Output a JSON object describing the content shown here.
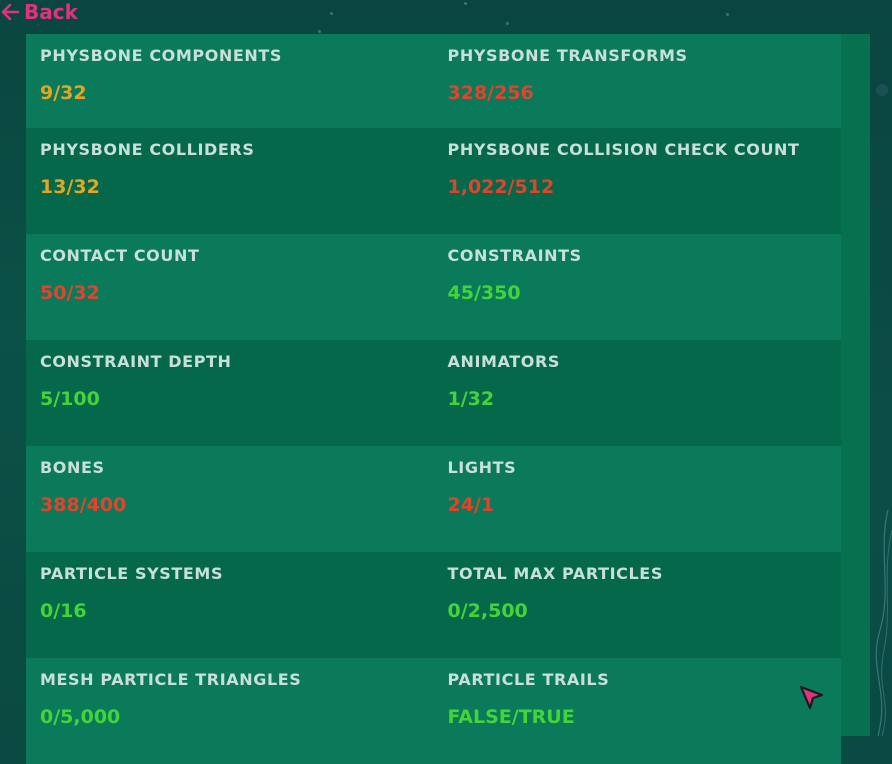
{
  "nav": {
    "back_label": "Back"
  },
  "colors": {
    "warning": "#e2a722",
    "error": "#e0452c",
    "ok": "#43d43a",
    "label": "#c8e0d8",
    "accent": "#e0337d"
  },
  "stats": [
    {
      "left": {
        "label": "PHYSBONE COMPONENTS",
        "value": "9/32",
        "status": "warning"
      },
      "right": {
        "label": "PHYSBONE TRANSFORMS",
        "value": "328/256",
        "status": "error"
      }
    },
    {
      "left": {
        "label": "PHYSBONE COLLIDERS",
        "value": "13/32",
        "status": "warning"
      },
      "right": {
        "label": "PHYSBONE COLLISION CHECK COUNT",
        "value": "1,022/512",
        "status": "error"
      }
    },
    {
      "left": {
        "label": "CONTACT COUNT",
        "value": "50/32",
        "status": "error"
      },
      "right": {
        "label": "CONSTRAINTS",
        "value": "45/350",
        "status": "ok"
      }
    },
    {
      "left": {
        "label": "CONSTRAINT DEPTH",
        "value": "5/100",
        "status": "ok"
      },
      "right": {
        "label": "ANIMATORS",
        "value": "1/32",
        "status": "ok"
      }
    },
    {
      "left": {
        "label": "BONES",
        "value": "388/400",
        "status": "error"
      },
      "right": {
        "label": "LIGHTS",
        "value": "24/1",
        "status": "error"
      }
    },
    {
      "left": {
        "label": "PARTICLE SYSTEMS",
        "value": "0/16",
        "status": "ok"
      },
      "right": {
        "label": "TOTAL MAX PARTICLES",
        "value": "0/2,500",
        "status": "ok"
      }
    },
    {
      "left": {
        "label": "MESH PARTICLE TRIANGLES",
        "value": "0/5,000",
        "status": "ok"
      },
      "right": {
        "label": "PARTICLE TRAILS",
        "value": "FALSE/TRUE",
        "status": "ok"
      }
    }
  ]
}
